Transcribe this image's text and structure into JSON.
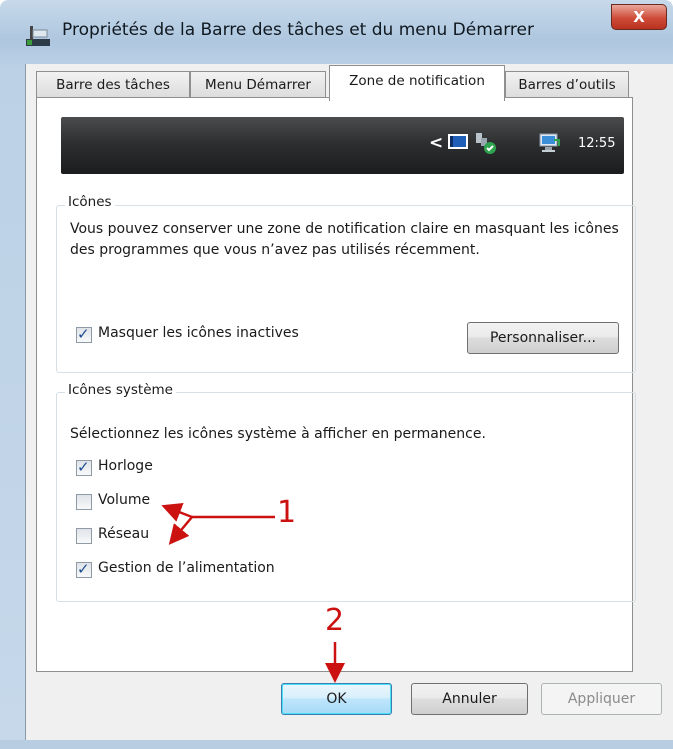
{
  "window": {
    "title": "Propriétés de la Barre des tâches et du menu Démarrer",
    "close_glyph": "X"
  },
  "tabs": [
    {
      "label": "Barre des tâches"
    },
    {
      "label": "Menu Démarrer"
    },
    {
      "label": "Zone de notification",
      "active": true
    },
    {
      "label": "Barres d’outils"
    }
  ],
  "taskbar_preview": {
    "chevron": "<",
    "icons": [
      "monitor-tray-icon",
      "network-tray-icon",
      "computer-tray-icon"
    ],
    "clock": "12:55"
  },
  "icons_group": {
    "title": "Icônes",
    "description": "Vous pouvez conserver une zone de notification claire en masquant les icônes des programmes que vous n’avez pas utilisés récemment.",
    "hide_inactive": {
      "label": "Masquer les icônes inactives",
      "checked": true
    },
    "customize_button": "Personnaliser..."
  },
  "system_icons_group": {
    "title": "Icônes système",
    "instruction": "Sélectionnez les icônes système à afficher en permanence.",
    "items": [
      {
        "label": "Horloge",
        "checked": true
      },
      {
        "label": "Volume",
        "checked": false
      },
      {
        "label": "Réseau",
        "checked": false
      },
      {
        "label": "Gestion de l’alimentation",
        "checked": true
      }
    ]
  },
  "buttons": {
    "ok": "OK",
    "cancel": "Annuler",
    "apply": "Appliquer"
  },
  "annotations": {
    "label_1": "1",
    "label_2": "2",
    "color": "#cc1111"
  },
  "colors": {
    "window_frame": "#b9cde2",
    "close_button": "#cf4b38",
    "default_button_border": "#3c7fb1",
    "checkmark": "#1f4d90"
  }
}
